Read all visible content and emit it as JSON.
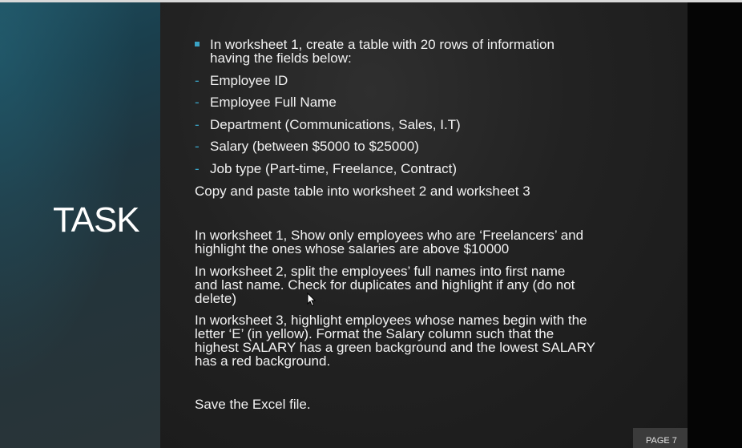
{
  "slide": {
    "title": "TASK",
    "intro_line_1": "In worksheet 1, create a table with 20 rows of information",
    "intro_line_2": "having the fields below:",
    "fields": [
      "Employee ID",
      "Employee Full Name",
      "Department (Communications, Sales, I.T)",
      "Salary (between $5000 to $25000)",
      "Job type (Part-time, Freelance, Contract)"
    ],
    "copy_line": "Copy and paste table into worksheet 2 and worksheet 3",
    "ws1_line_1": "In worksheet 1, Show only employees who are ‘Freelancers’ and",
    "ws1_line_2": "highlight the ones whose salaries are above $10000",
    "ws2_line_1": "In worksheet 2, split the employees’ full names into first name",
    "ws2_line_2": "and last name. Check for duplicates and highlight if any (do not",
    "ws2_line_3": "delete)",
    "ws3_line_1": "In worksheet 3, highlight employees whose names begin with the",
    "ws3_line_2": "letter ‘E’ (in yellow). Format the Salary column such that the",
    "ws3_line_3": "highest SALARY has a green background and the lowest SALARY",
    "ws3_line_4": "has a red background.",
    "save_line": "Save the Excel file.",
    "page_label": "PAGE 7",
    "bullet_marker": "-"
  },
  "colors": {
    "accent": "#3aa3c5",
    "text": "#f2f2f2",
    "left_panel": "#1f3a45",
    "content_bg": "#242424"
  },
  "icons": {
    "cursor": "mouse-pointer-icon",
    "bullet": "square-bullet-icon"
  }
}
